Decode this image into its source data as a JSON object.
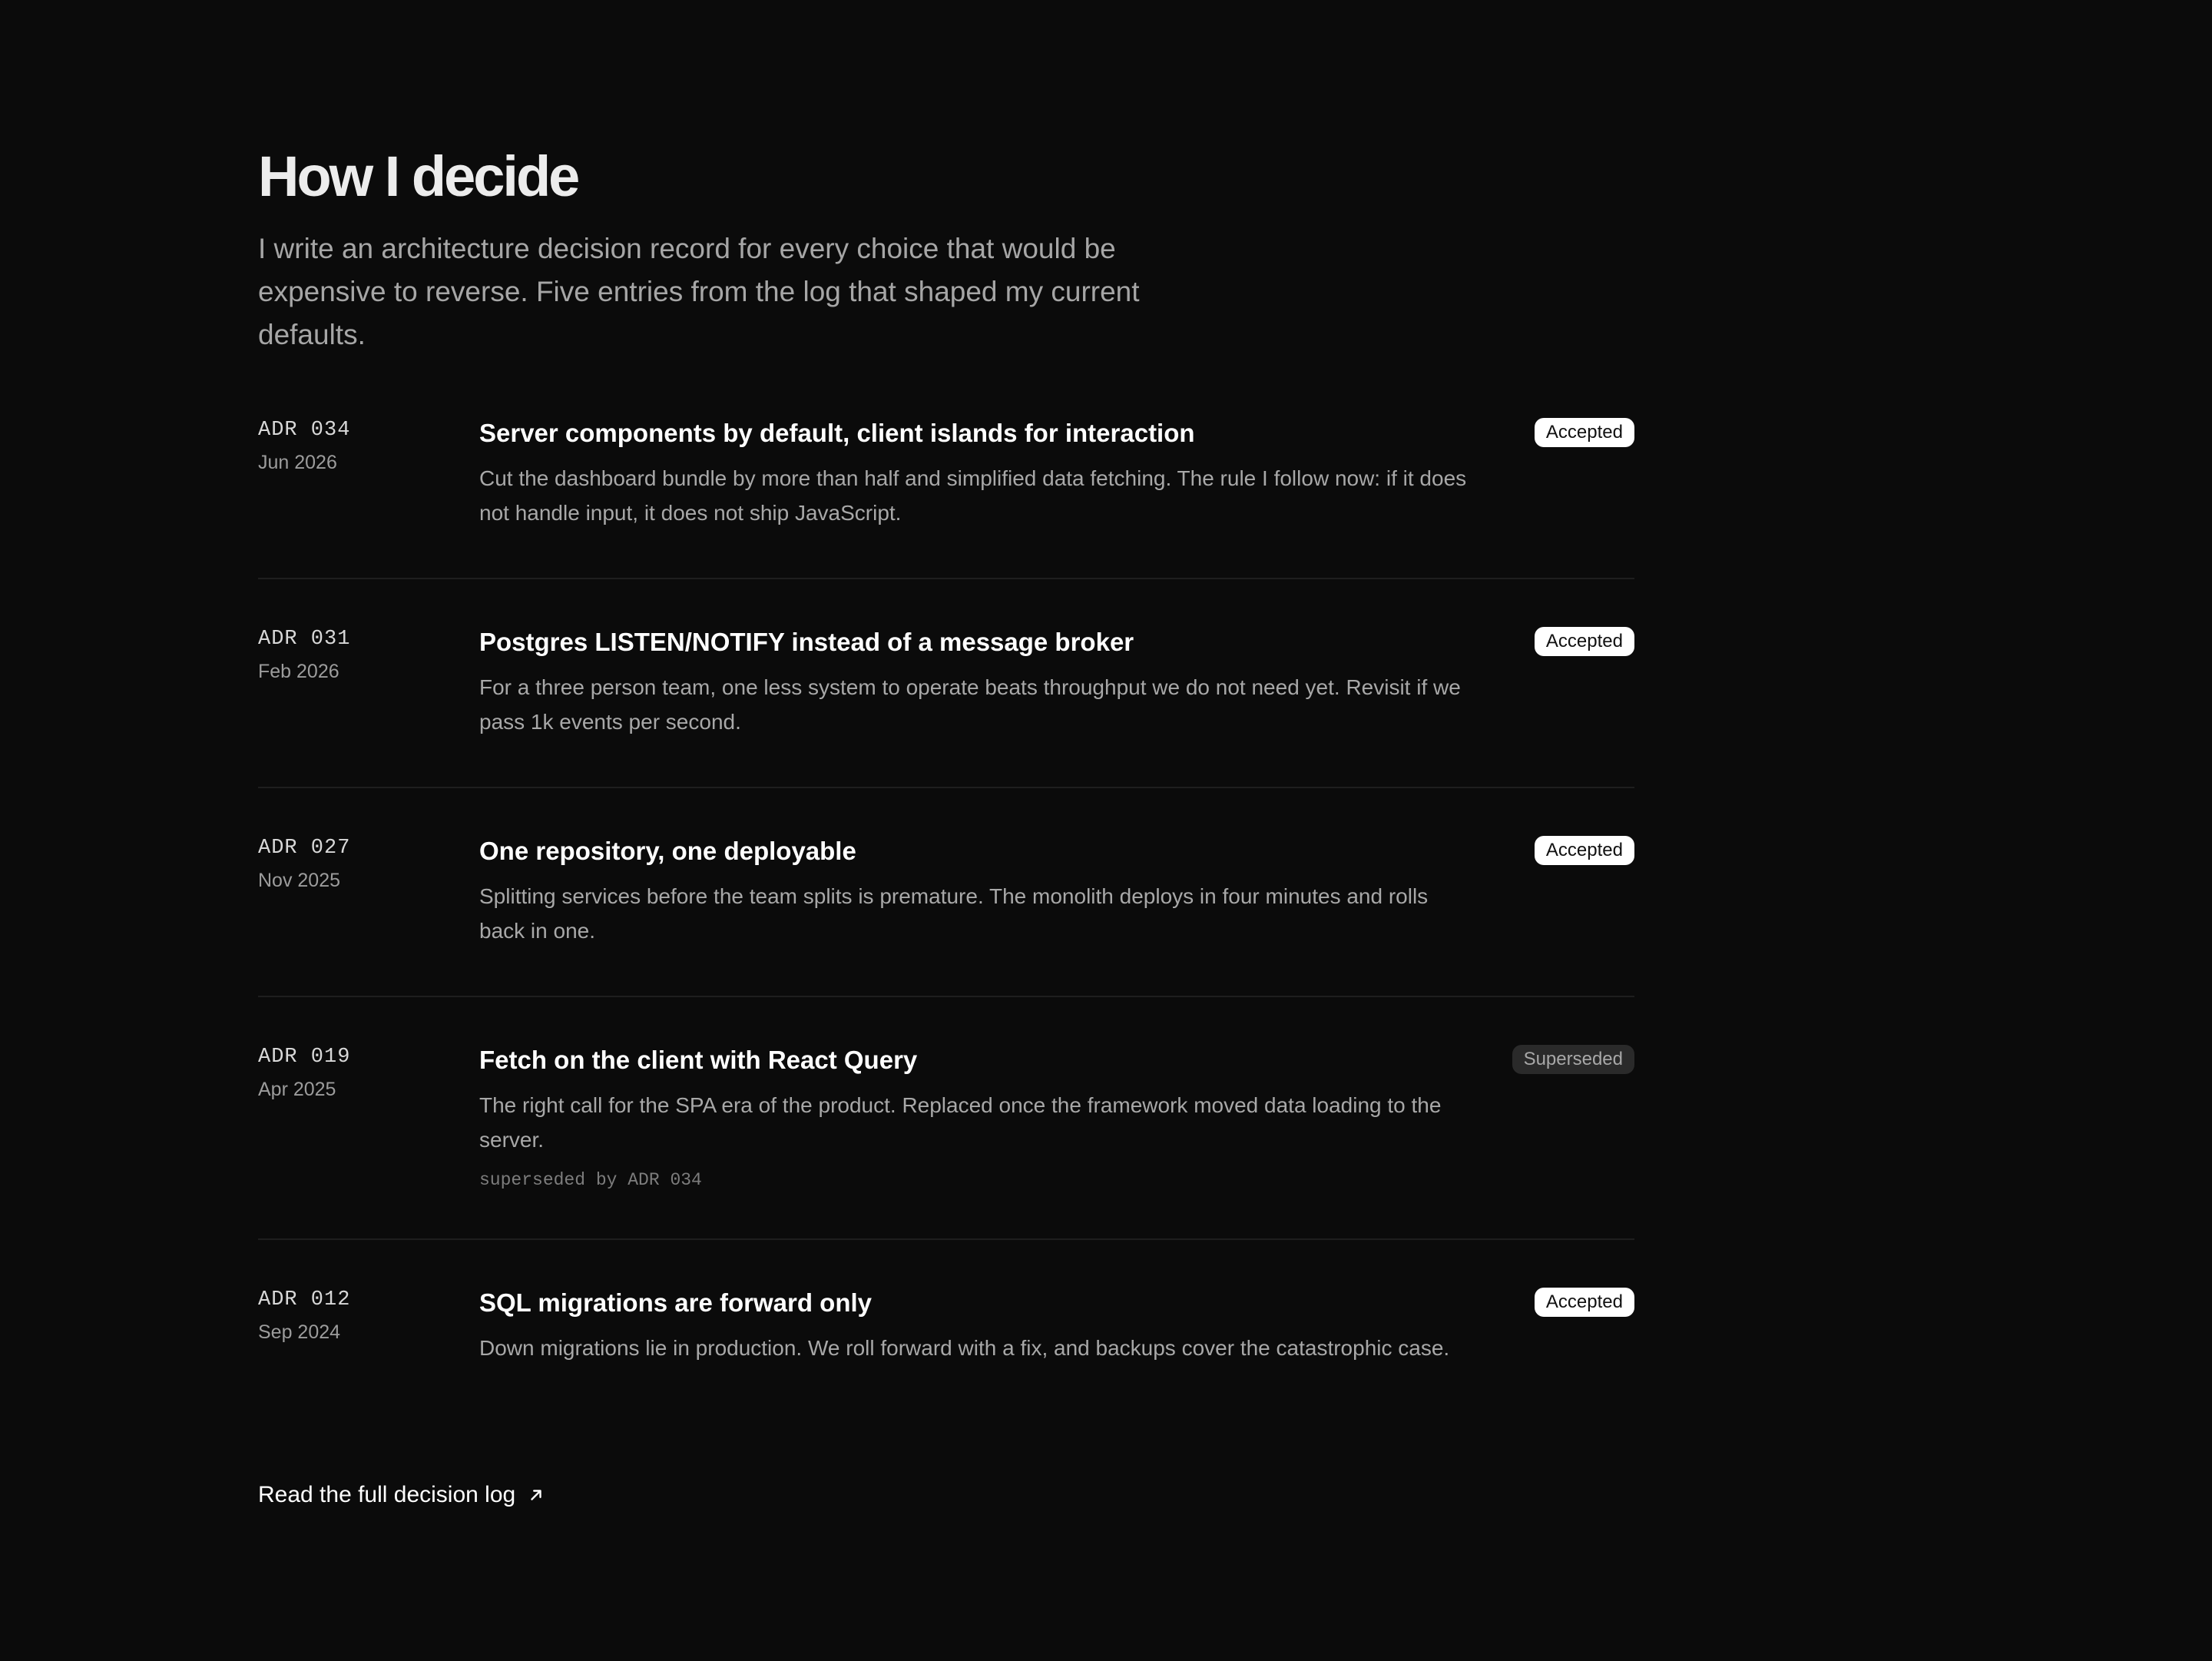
{
  "header": {
    "title": "How I decide",
    "intro": "I write an architecture decision record for every choice that would be expensive to reverse. Five entries from the log that shaped my current defaults."
  },
  "decisions": [
    {
      "id": "ADR 034",
      "date": "Jun 2026",
      "title": "Server components by default, client islands for interaction",
      "summary": "Cut the dashboard bundle by more than half and simplified data fetching. The rule I follow now: if it does not handle input, it does not ship JavaScript.",
      "status": "Accepted"
    },
    {
      "id": "ADR 031",
      "date": "Feb 2026",
      "title": "Postgres LISTEN/NOTIFY instead of a message broker",
      "summary": "For a three person team, one less system to operate beats throughput we do not need yet. Revisit if we pass 1k events per second.",
      "status": "Accepted"
    },
    {
      "id": "ADR 027",
      "date": "Nov 2025",
      "title": "One repository, one deployable",
      "summary": "Splitting services before the team splits is premature. The monolith deploys in four minutes and rolls back in one.",
      "status": "Accepted"
    },
    {
      "id": "ADR 019",
      "date": "Apr 2025",
      "title": "Fetch on the client with React Query",
      "summary": "The right call for the SPA era of the product. Replaced once the framework moved data loading to the server.",
      "note": "superseded by ADR 034",
      "status": "Superseded"
    },
    {
      "id": "ADR 012",
      "date": "Sep 2024",
      "title": "SQL migrations are forward only",
      "summary": "Down migrations lie in production. We roll forward with a fix, and backups cover the catastrophic case.",
      "status": "Accepted"
    }
  ],
  "footer": {
    "link_label": "Read the full decision log",
    "link_icon": "arrow-up-right-icon"
  },
  "colors": {
    "background": "#0b0b0b",
    "accepted_badge": "#ffffff",
    "superseded_badge": "#2a2a2a"
  }
}
